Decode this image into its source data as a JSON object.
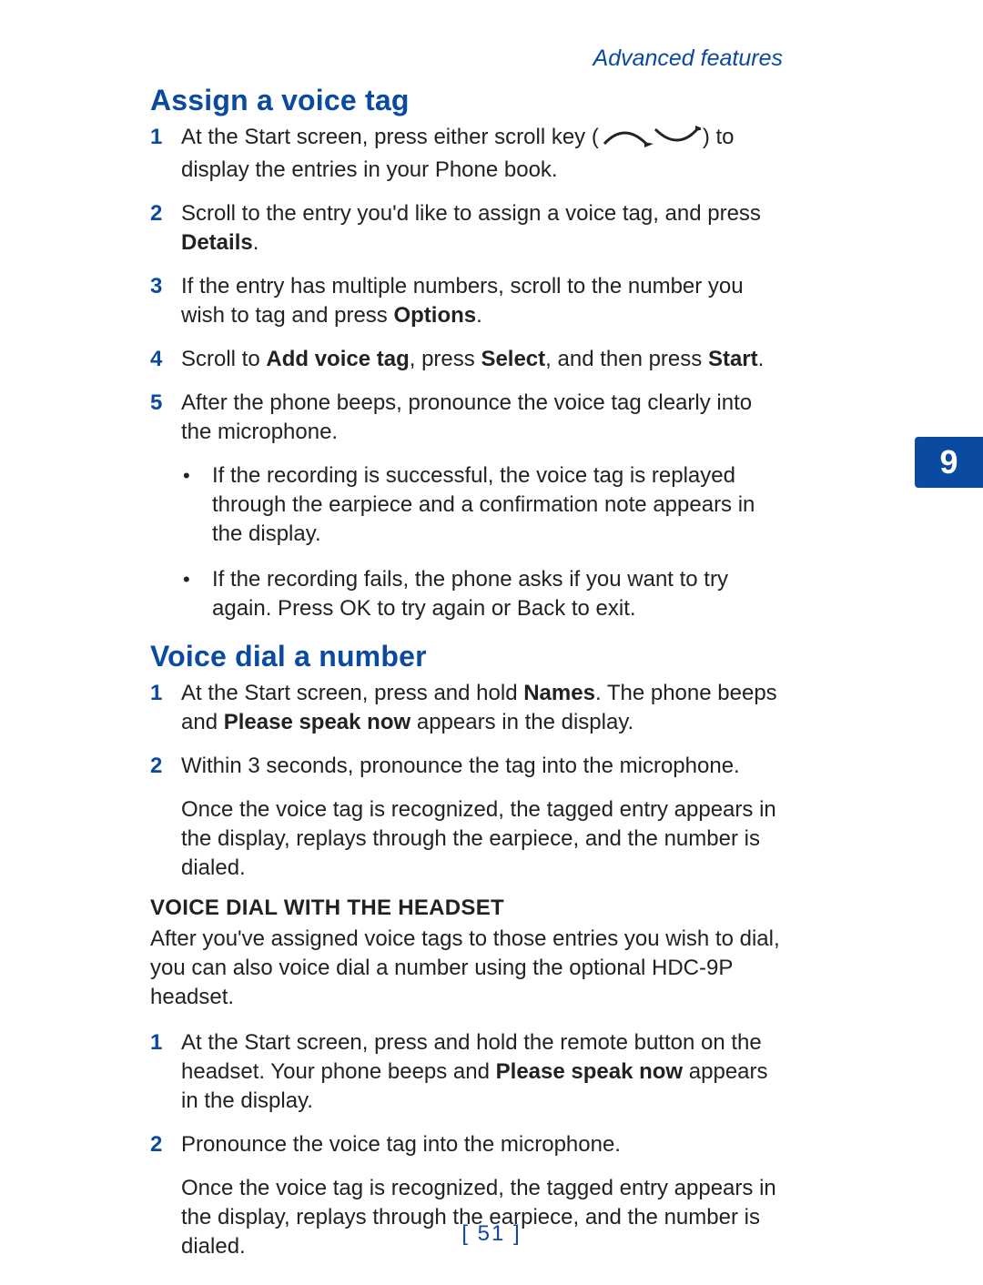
{
  "running_head": "Advanced features",
  "chapter_tab": "9",
  "page_number_display": "[ 51 ]",
  "icons": {
    "scroll_up_name": "scroll-up-icon",
    "scroll_down_name": "scroll-down-icon"
  },
  "section1": {
    "title": "Assign a voice tag",
    "steps": [
      {
        "n": "1",
        "pre_icon": "At the Start screen, press either scroll key (",
        "post_icon": ") to display the entries in your Phone book."
      },
      {
        "n": "2",
        "text_a": "Scroll to the entry you'd like to assign a voice tag, and press ",
        "bold_a": "Details",
        "text_b": "."
      },
      {
        "n": "3",
        "text_a": "If the entry has multiple numbers, scroll to the number you wish to tag and press ",
        "bold_a": "Options",
        "text_b": "."
      },
      {
        "n": "4",
        "text_a": "Scroll to ",
        "bold_a": "Add voice tag",
        "text_b": ", press ",
        "bold_b": "Select",
        "text_c": ", and then press ",
        "bold_c": "Start",
        "text_d": "."
      },
      {
        "n": "5",
        "text_a": "After the phone beeps, pronounce the voice tag clearly into the microphone."
      }
    ],
    "bullets": [
      {
        "text_a": "If the recording is successful, the voice tag is replayed through the earpiece and a confirmation note appears in the display."
      },
      {
        "text_a": "If the recording fails, the phone asks if you want to try again. Press ",
        "bold_a": "OK",
        "text_b": " to try again or ",
        "bold_b": "Back",
        "text_c": " to exit."
      }
    ]
  },
  "section2": {
    "title": "Voice dial a number",
    "steps": [
      {
        "n": "1",
        "text_a": "At the Start screen, press and hold ",
        "bold_a": "Names",
        "text_b": ". The phone beeps and ",
        "bold_b": "Please speak now",
        "text_c": " appears in the display."
      },
      {
        "n": "2",
        "text_a": "Within 3 seconds, pronounce the tag into the microphone."
      }
    ],
    "after_steps_para": "Once the voice tag is recognized, the tagged entry appears in the display, replays through the earpiece, and the number is dialed.",
    "sub": {
      "heading": "VOICE DIAL WITH THE HEADSET",
      "intro": "After you've assigned voice tags to those entries you wish to dial, you can also voice dial a number using the optional HDC-9P headset.",
      "steps": [
        {
          "n": "1",
          "text_a": "At the Start screen, press and hold the remote button on the headset. Your phone beeps and ",
          "bold_a": "Please speak now",
          "text_b": " appears in the display."
        },
        {
          "n": "2",
          "text_a": "Pronounce the voice tag into the microphone."
        }
      ],
      "after_steps_para": "Once the voice tag is recognized, the tagged entry appears in the display, replays through the earpiece, and the number is dialed."
    }
  }
}
